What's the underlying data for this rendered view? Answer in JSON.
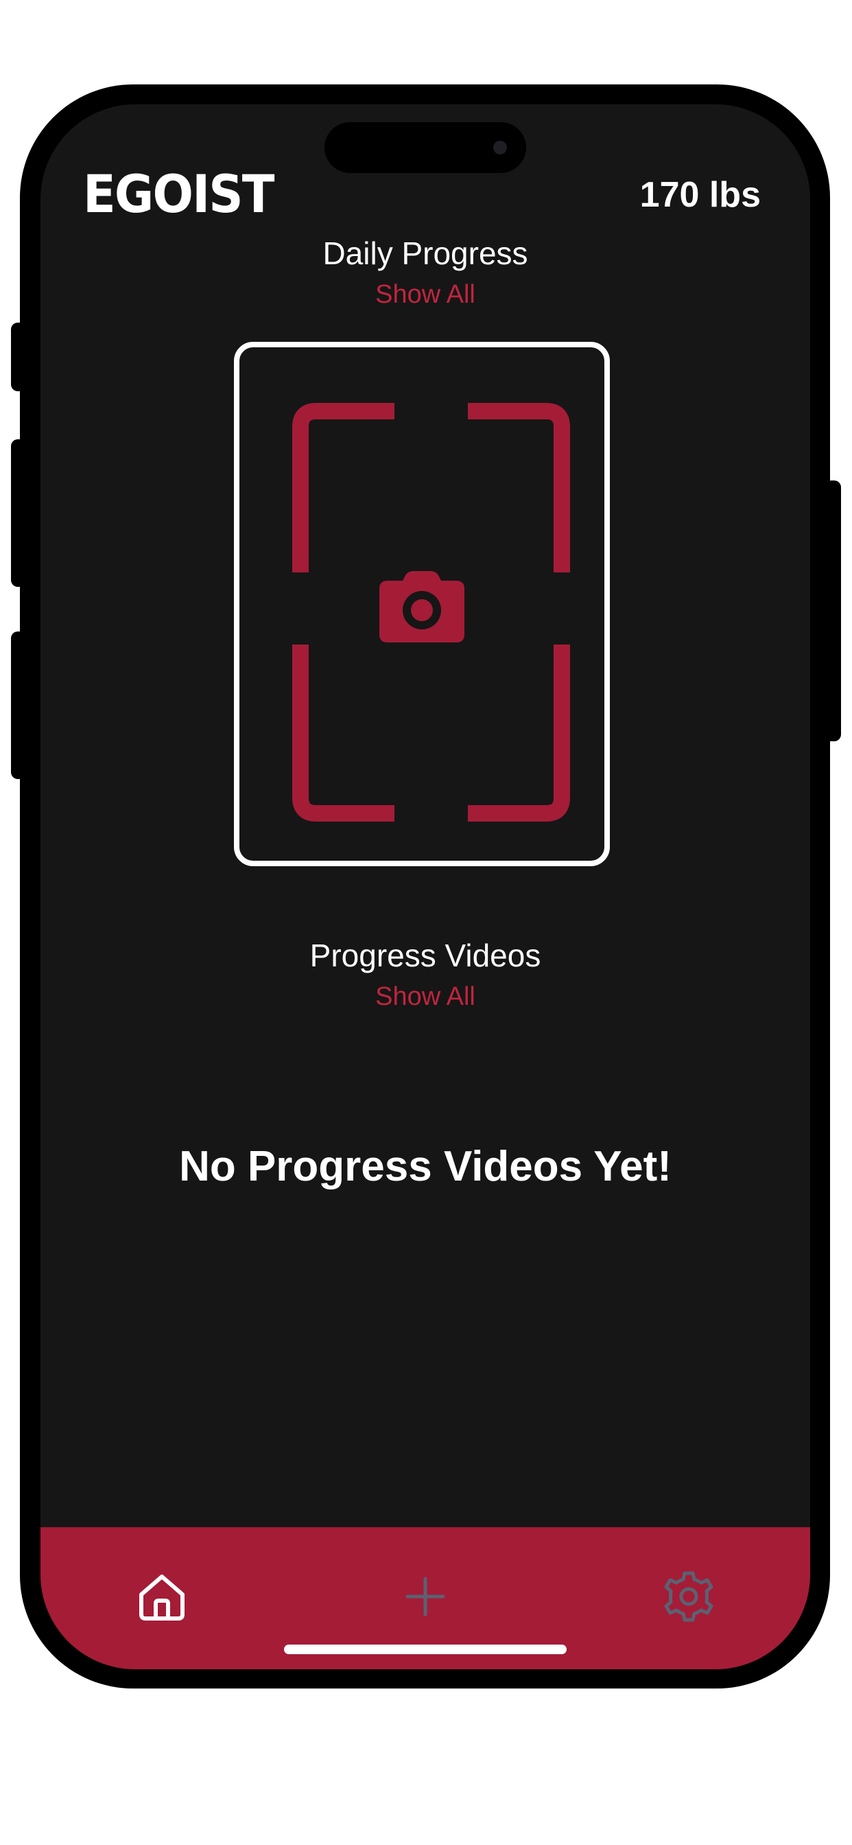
{
  "header": {
    "logo_text": "EGOIST",
    "weight_value": "170 lbs"
  },
  "daily_progress": {
    "title": "Daily Progress",
    "show_all_label": "Show All",
    "capture_icon": "camera-icon"
  },
  "progress_videos": {
    "title": "Progress Videos",
    "show_all_label": "Show All",
    "empty_message": "No Progress Videos Yet!"
  },
  "tab_bar": {
    "items": [
      {
        "name": "home",
        "icon": "home-icon",
        "active": true
      },
      {
        "name": "add",
        "icon": "plus-icon",
        "active": false
      },
      {
        "name": "settings",
        "icon": "gear-icon",
        "active": false
      }
    ]
  },
  "colors": {
    "background": "#161616",
    "accent": "#a51c37",
    "accent_text": "#c0253f",
    "text": "#ffffff",
    "inactive_icon": "#5a6272"
  }
}
